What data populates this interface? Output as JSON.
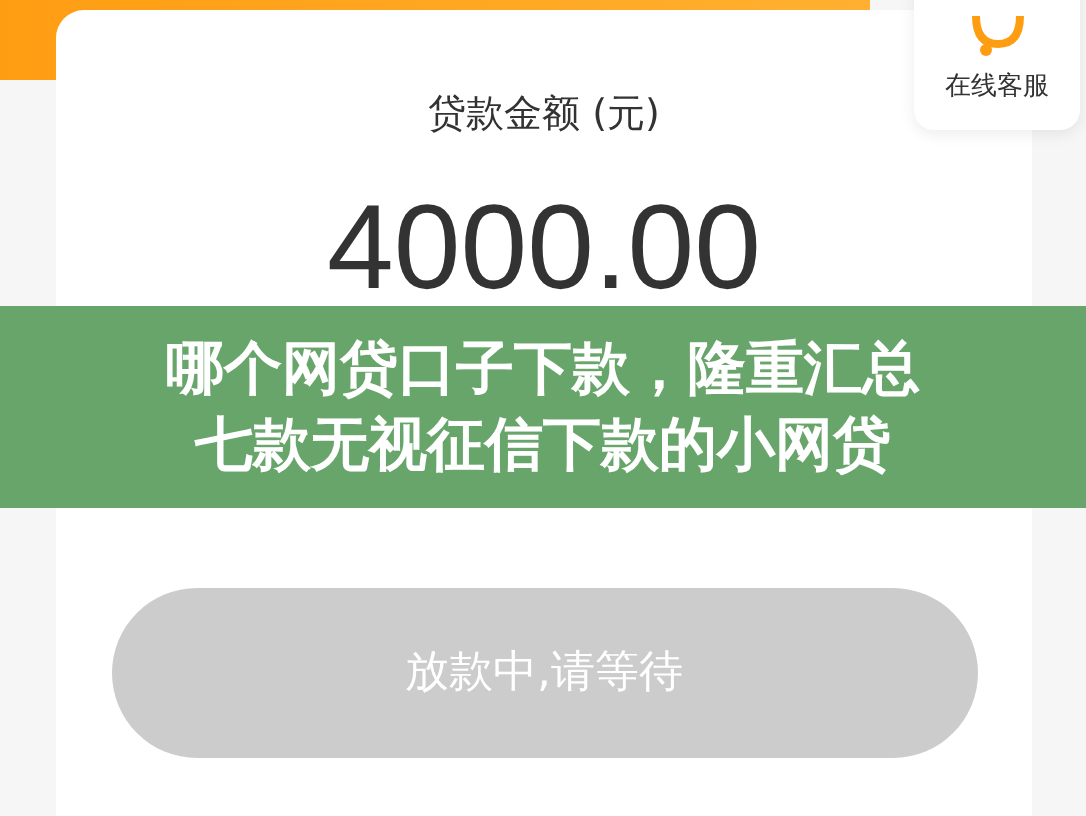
{
  "loan": {
    "label": "贷款金额 (元)",
    "amount": "4000.00"
  },
  "service": {
    "label": "在线客服"
  },
  "button": {
    "label": "放款中,请等待",
    "disabled": true
  },
  "caption_banner": {
    "lines": [
      "哪个网贷口子下款，隆重汇总",
      "七款无视征信下款的小网贷"
    ]
  }
}
